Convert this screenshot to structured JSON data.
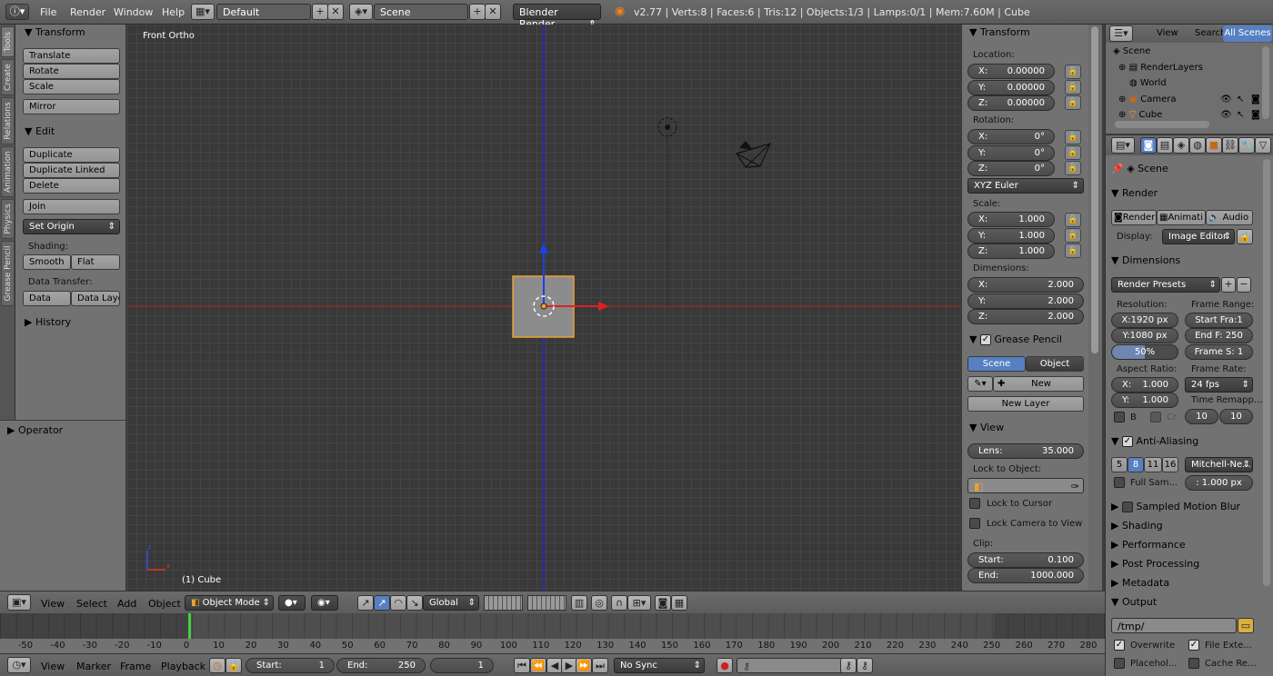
{
  "topbar": {
    "menus": [
      "File",
      "Render",
      "Window",
      "Help"
    ],
    "screen_layout": "Default",
    "scene": "Scene",
    "render_engine": "Blender Render",
    "info": "v2.77 | Verts:8 | Faces:6 | Tris:12 | Objects:1/3 | Lamps:0/1 | Mem:7.60M | Cube"
  },
  "side_tabs": [
    "Tools",
    "Create",
    "Relations",
    "Animation",
    "Physics",
    "Grease Pencil"
  ],
  "tool_shelf": {
    "transform_title": "Transform",
    "transform_buttons": [
      "Translate",
      "Rotate",
      "Scale",
      "Mirror"
    ],
    "edit_title": "Edit",
    "edit_buttons": [
      "Duplicate",
      "Duplicate Linked",
      "Delete",
      "Join"
    ],
    "set_origin": "Set Origin",
    "shading_label": "Shading:",
    "smooth": "Smooth",
    "flat": "Flat",
    "data_transfer_label": "Data Transfer:",
    "data": "Data",
    "data_layout": "Data Layo",
    "history": "History",
    "operator": "Operator"
  },
  "viewport": {
    "view_name": "Front Ortho",
    "object_label": "(1) Cube",
    "colors": {
      "x_axis": "#c41a1a",
      "z_axis": "#1a1ac4",
      "selection": "#f0a030"
    }
  },
  "n_panel": {
    "transform_title": "Transform",
    "location_label": "Location:",
    "location": [
      {
        "axis": "X:",
        "value": "0.00000"
      },
      {
        "axis": "Y:",
        "value": "0.00000"
      },
      {
        "axis": "Z:",
        "value": "0.00000"
      }
    ],
    "rotation_label": "Rotation:",
    "rotation": [
      {
        "axis": "X:",
        "value": "0°"
      },
      {
        "axis": "Y:",
        "value": "0°"
      },
      {
        "axis": "Z:",
        "value": "0°"
      }
    ],
    "rotation_mode": "XYZ Euler",
    "scale_label": "Scale:",
    "scale": [
      {
        "axis": "X:",
        "value": "1.000"
      },
      {
        "axis": "Y:",
        "value": "1.000"
      },
      {
        "axis": "Z:",
        "value": "1.000"
      }
    ],
    "dimensions_label": "Dimensions:",
    "dimensions": [
      {
        "axis": "X:",
        "value": "2.000"
      },
      {
        "axis": "Y:",
        "value": "2.000"
      },
      {
        "axis": "Z:",
        "value": "2.000"
      }
    ],
    "grease_pencil_title": "Grease Pencil",
    "gp_scene": "Scene",
    "gp_object": "Object",
    "gp_new": "New",
    "gp_new_layer": "New Layer",
    "view_title": "View",
    "lens_label": "Lens:",
    "lens_value": "35.000",
    "lock_to_object": "Lock to Object:",
    "lock_to_cursor": "Lock to Cursor",
    "lock_camera": "Lock Camera to View",
    "clip_label": "Clip:",
    "clip_start_label": "Start:",
    "clip_start": "0.100",
    "clip_end_label": "End:",
    "clip_end": "1000.000"
  },
  "outliner": {
    "menus": [
      "View",
      "Search"
    ],
    "filter": "All Scenes",
    "items": [
      "Scene",
      "RenderLayers",
      "World",
      "Camera",
      "Cube"
    ]
  },
  "properties": {
    "context": "Scene",
    "render_title": "Render",
    "render_tabs": [
      "Render",
      "Animati",
      "Audio"
    ],
    "display_label": "Display:",
    "display_value": "Image Editor",
    "dimensions_title": "Dimensions",
    "render_presets": "Render Presets",
    "resolution_label": "Resolution:",
    "res_x": "X:1920 px",
    "res_y": "Y:1080 px",
    "res_pct": "50%",
    "frame_range_label": "Frame Range:",
    "start_frame": "Start Fra:1",
    "end_frame": "End F: 250",
    "frame_step": "Frame S: 1",
    "aspect_label": "Aspect Ratio:",
    "aspect_x_label": "X:",
    "aspect_x": "1.000",
    "aspect_y_label": "Y:",
    "aspect_y": "1.000",
    "frame_rate_label": "Frame Rate:",
    "frame_rate": "24 fps",
    "time_remap_label": "Time Remapp...",
    "remap_old": "10",
    "remap_new": "10",
    "border_b": "B",
    "border_cr": "Cr",
    "aa_title": "Anti-Aliasing",
    "aa_samples": [
      "5",
      "8",
      "11",
      "16"
    ],
    "aa_filter": "Mitchell-Ne...",
    "full_sample": "Full Sam...",
    "filter_size": ": 1.000 px",
    "collapsed_panels": [
      "Sampled Motion Blur",
      "Shading",
      "Performance",
      "Post Processing",
      "Metadata"
    ],
    "output_title": "Output",
    "output_path": "/tmp/",
    "overwrite": "Overwrite",
    "file_extensions": "File Exte...",
    "placeholders": "Placehol...",
    "cache_result": "Cache Re..."
  },
  "view3d_header": {
    "menus": [
      "View",
      "Select",
      "Add",
      "Object"
    ],
    "mode": "Object Mode",
    "orientation": "Global"
  },
  "timeline": {
    "ticks": [
      "-50",
      "-40",
      "-30",
      "-20",
      "-10",
      "0",
      "10",
      "20",
      "30",
      "40",
      "50",
      "60",
      "70",
      "80",
      "90",
      "100",
      "110",
      "120",
      "130",
      "140",
      "150",
      "160",
      "170",
      "180",
      "190",
      "200",
      "210",
      "220",
      "230",
      "240",
      "250",
      "260",
      "270",
      "280"
    ]
  },
  "timeline_header": {
    "menus": [
      "View",
      "Marker",
      "Frame",
      "Playback"
    ],
    "start_label": "Start:",
    "start": "1",
    "end_label": "End:",
    "end": "250",
    "current": "1",
    "sync": "No Sync"
  }
}
